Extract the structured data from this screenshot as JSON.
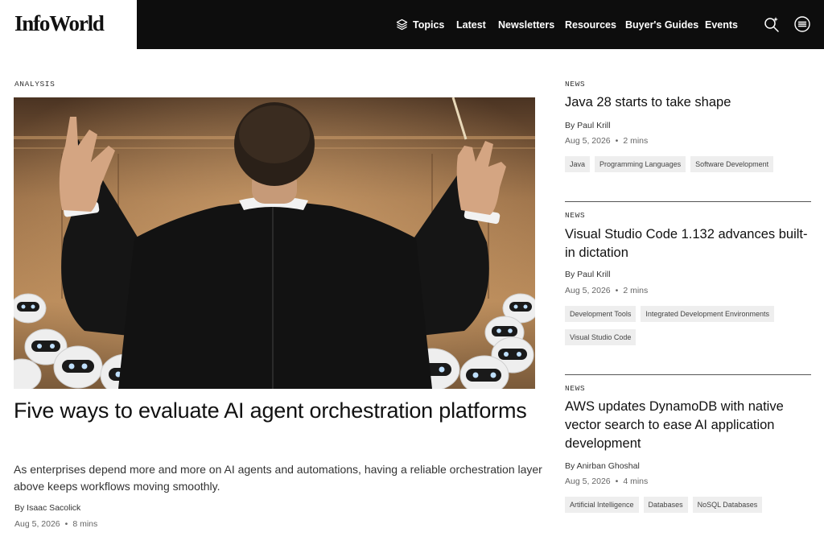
{
  "header": {
    "logo": "InfoWorld",
    "nav": [
      {
        "label": "Topics",
        "icon": "layers-icon"
      },
      {
        "label": "Latest"
      },
      {
        "label": "Newsletters"
      },
      {
        "label": "Resources"
      },
      {
        "label": "Buyer's Guides"
      },
      {
        "label": "Events"
      }
    ],
    "icons": [
      "ai-search-icon",
      "menu-icon"
    ]
  },
  "main": {
    "kicker": "ANALYSIS",
    "image_alt": "Conductor in a black suit leading an orchestra of small white robots",
    "title": "Five ways to evaluate AI agent orchestration platforms",
    "deck": "As enterprises depend more and more on AI agents and automations, having a reliable orchestration layer above keeps workflows moving smoothly.",
    "byline": "By Isaac Sacolick",
    "date": "Aug 5, 2026",
    "read_time": "8 mins"
  },
  "sidebar": [
    {
      "kicker": "NEWS",
      "title": "Java 28 starts to take shape",
      "byline": "By Paul Krill",
      "date": "Aug 5, 2026",
      "read_time": "2 mins",
      "tags": [
        "Java",
        "Programming Languages",
        "Software Development"
      ]
    },
    {
      "kicker": "NEWS",
      "title": "Visual Studio Code 1.132 advances built-in dictation",
      "byline": "By Paul Krill",
      "date": "Aug 5, 2026",
      "read_time": "2 mins",
      "tags": [
        "Development Tools",
        "Integrated Development Environments",
        "Visual Studio Code"
      ]
    },
    {
      "kicker": "NEWS",
      "title": "AWS updates DynamoDB with native vector search to ease AI application development",
      "byline": "By Anirban Ghoshal",
      "date": "Aug 5, 2026",
      "read_time": "4 mins",
      "tags": [
        "Artificial Intelligence",
        "Databases",
        "NoSQL Databases"
      ]
    }
  ],
  "meta_separator": "•"
}
